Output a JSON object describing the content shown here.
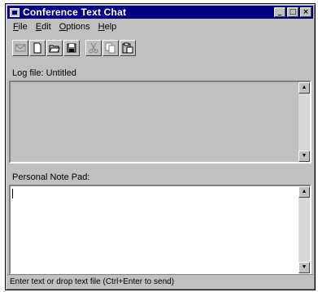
{
  "window": {
    "title": "Conference Text Chat"
  },
  "title_buttons": {
    "minimize": "_",
    "maximize": "□",
    "close": "×"
  },
  "menu": [
    {
      "first": "F",
      "rest": "ile"
    },
    {
      "first": "E",
      "rest": "dit"
    },
    {
      "first": "O",
      "rest": "ptions"
    },
    {
      "first": "H",
      "rest": "elp"
    }
  ],
  "toolbar": {
    "icons": [
      "send-icon",
      "new-icon",
      "open-icon",
      "save-icon",
      "cut-icon",
      "copy-icon",
      "paste-icon"
    ]
  },
  "log": {
    "label": "Log file: Untitled",
    "text": ""
  },
  "notepad": {
    "label": "Personal Note Pad:",
    "text": ""
  },
  "status": {
    "text": "Enter text or drop text file (Ctrl+Enter to send)"
  },
  "colors": {
    "titlebar": "#000080",
    "face": "#c0c0c0",
    "log_bg": "#c0c0c0",
    "notepad_bg": "#ffffff"
  }
}
